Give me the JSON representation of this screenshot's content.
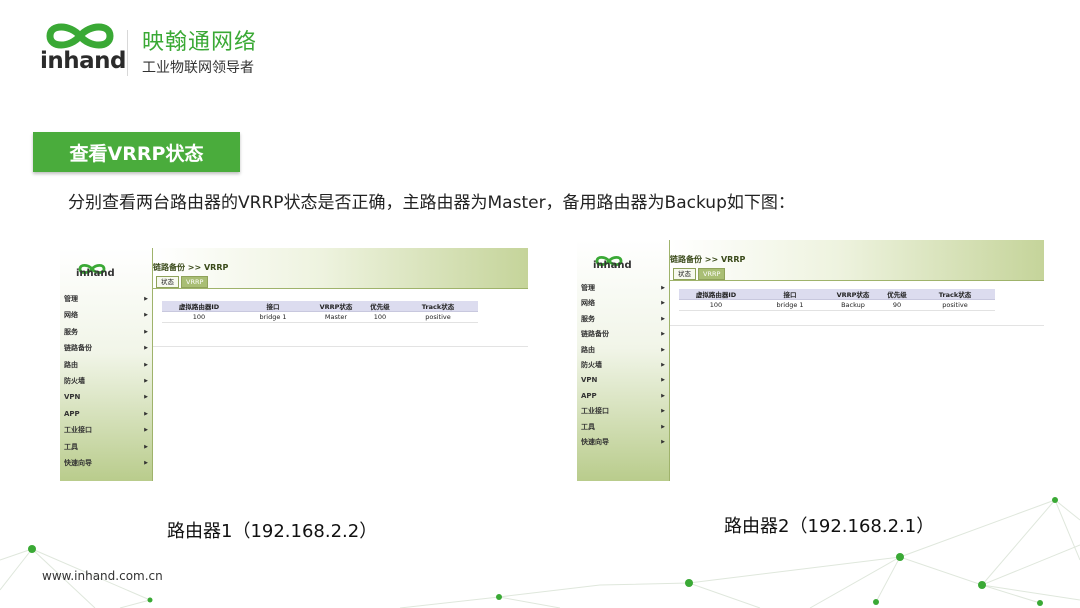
{
  "brand": {
    "logo_text": "inhand",
    "name_cn": "映翰通网络",
    "slogan": "工业物联网领导者",
    "accent_color": "#4aac3c"
  },
  "section": {
    "title": "查看VRRP状态",
    "description": "分别查看两台路由器的VRRP状态是否正确，主路由器为Master，备用路由器为Backup如下图："
  },
  "routers": [
    {
      "logo_text": "inhand",
      "breadcrumb": "链路备份 >> VRRP",
      "tabs": [
        "状态",
        "VRRP"
      ],
      "menu": [
        "管理",
        "网络",
        "服务",
        "链路备份",
        "路由",
        "防火墙",
        "VPN",
        "APP",
        "工业接口",
        "工具",
        "快速向导"
      ],
      "table": {
        "headers": [
          "虚拟路由器ID",
          "接口",
          "VRRP状态",
          "优先级",
          "Track状态"
        ],
        "row": [
          "100",
          "bridge 1",
          "Master",
          "100",
          "positive"
        ]
      },
      "caption": "路由器1（192.168.2.2）"
    },
    {
      "logo_text": "inhand",
      "breadcrumb": "链路备份 >> VRRP",
      "tabs": [
        "状态",
        "VRRP"
      ],
      "menu": [
        "管理",
        "网络",
        "服务",
        "链路备份",
        "路由",
        "防火墙",
        "VPN",
        "APP",
        "工业接口",
        "工具",
        "快速向导"
      ],
      "table": {
        "headers": [
          "虚拟路由器ID",
          "接口",
          "VRRP状态",
          "优先级",
          "Track状态"
        ],
        "row": [
          "100",
          "bridge 1",
          "Backup",
          "90",
          "positive"
        ]
      },
      "caption": "路由器2（192.168.2.1）"
    }
  ],
  "footer": {
    "website": "www.inhand.com.cn"
  }
}
